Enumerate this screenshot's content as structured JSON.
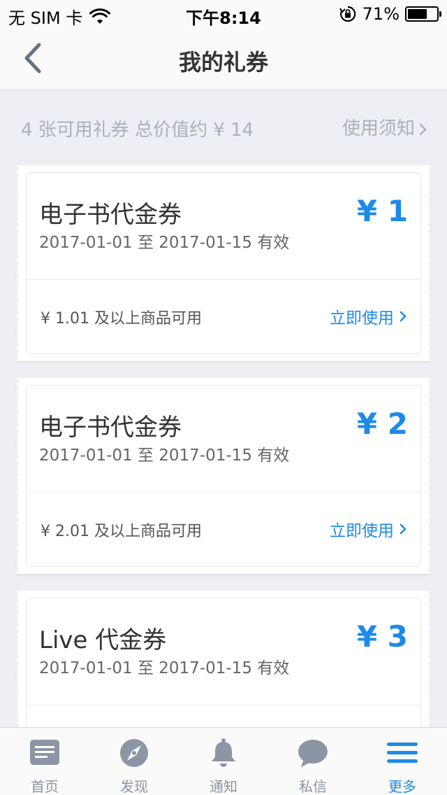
{
  "status_bar": {
    "carrier": "无 SIM 卡",
    "time": "下午8:14",
    "battery": "71%",
    "battery_level": 0.71,
    "wifi_icon": "wifi-icon",
    "lock_icon": "rotation-lock-icon"
  },
  "nav": {
    "title": "我的礼券",
    "back_icon": "back-chevron-icon"
  },
  "summary": {
    "text": "4 张可用礼券 总价值约 ¥ 14",
    "notice_link": "使用须知"
  },
  "coupons": [
    {
      "name": "电子书代金券",
      "validity": "2017-01-01 至 2017-01-15 有效",
      "amount": "¥ 1",
      "condition": "¥ 1.01 及以上商品可用",
      "action": "立即使用"
    },
    {
      "name": "电子书代金券",
      "validity": "2017-01-01 至 2017-01-15 有效",
      "amount": "¥ 2",
      "condition": "¥ 2.01 及以上商品可用",
      "action": "立即使用"
    },
    {
      "name": "Live 代金券",
      "validity": "2017-01-01 至 2017-01-15 有效",
      "amount": "¥ 3",
      "condition": "",
      "action": ""
    }
  ],
  "tabs": [
    {
      "label": "首页",
      "icon": "news-icon",
      "active": false
    },
    {
      "label": "发现",
      "icon": "compass-icon",
      "active": false
    },
    {
      "label": "通知",
      "icon": "bell-icon",
      "active": false
    },
    {
      "label": "私信",
      "icon": "chat-bubble-icon",
      "active": false
    },
    {
      "label": "更多",
      "icon": "menu-icon",
      "active": true
    }
  ],
  "colors": {
    "accent": "#1e8ae8",
    "background": "#eeeff4",
    "tab_inactive": "#8c95a3",
    "summary_text": "#aab0bb"
  }
}
